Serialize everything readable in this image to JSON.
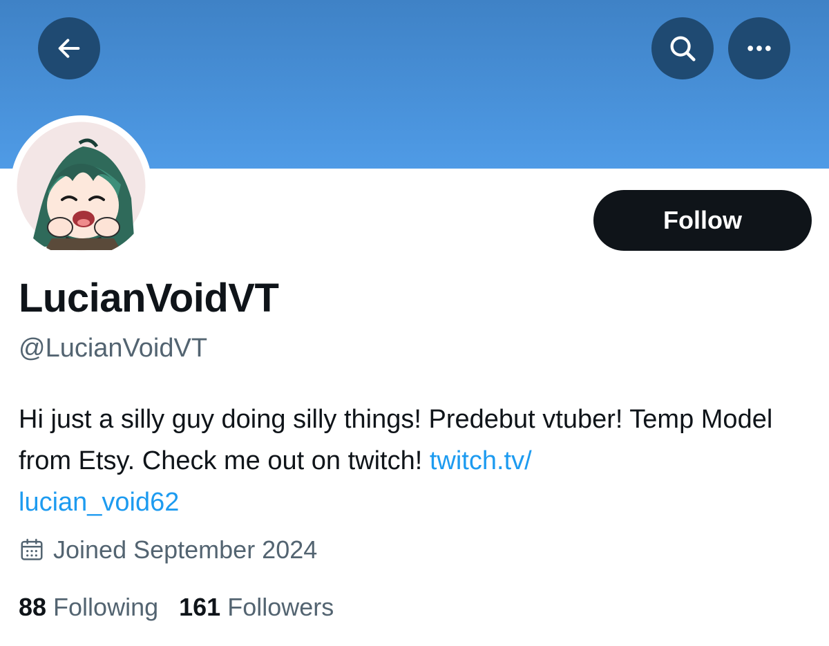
{
  "header": {
    "back_icon": "arrow-left-icon",
    "search_icon": "search-icon",
    "more_icon": "more-horizontal-icon",
    "banner_color": "#4a90d9",
    "button_color": "#1f4a72"
  },
  "profile": {
    "display_name": "LucianVoidVT",
    "handle": "@LucianVoidVT",
    "bio_text": "Hi just a silly guy doing silly things! Predebut vtuber! Temp Model from Etsy. Check me out on twitch!",
    "bio_link_line1": "twitch.tv/",
    "bio_link_line2": "lucian_void62",
    "joined_icon": "calendar-icon",
    "joined": "Joined September 2024",
    "follow_label": "Follow"
  },
  "stats": {
    "following_count": "88",
    "following_label": "Following",
    "followers_count": "161",
    "followers_label": "Followers"
  },
  "colors": {
    "text_primary": "#0f1419",
    "text_secondary": "#536471",
    "link": "#1d9bf0",
    "follow_bg": "#0f1419"
  }
}
